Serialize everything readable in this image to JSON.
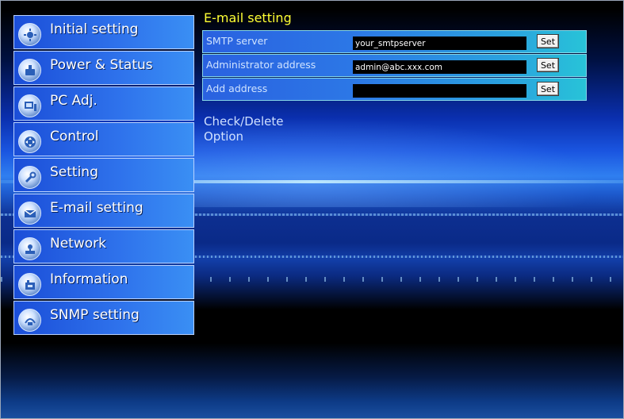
{
  "sidebar": {
    "items": [
      {
        "label": "Initial setting",
        "icon": "initial-setting-icon"
      },
      {
        "label": "Power & Status",
        "icon": "power-status-icon"
      },
      {
        "label": "PC Adj.",
        "icon": "pc-adj-icon"
      },
      {
        "label": "Control",
        "icon": "control-icon"
      },
      {
        "label": "Setting",
        "icon": "setting-icon"
      },
      {
        "label": "E-mail setting",
        "icon": "email-icon"
      },
      {
        "label": "Network",
        "icon": "network-icon"
      },
      {
        "label": "Information",
        "icon": "information-icon"
      },
      {
        "label": "SNMP setting",
        "icon": "snmp-icon"
      }
    ]
  },
  "main": {
    "title": "E-mail setting",
    "rows": [
      {
        "label": "SMTP server",
        "value": "your_smtpserver",
        "button": "Set"
      },
      {
        "label": "Administrator address",
        "value": "admin@abc.xxx.com",
        "button": "Set"
      },
      {
        "label": "Add address",
        "value": "",
        "button": "Set"
      }
    ],
    "links": {
      "check_delete": "Check/Delete",
      "option": "Option"
    }
  },
  "colors": {
    "title": "#ffff33",
    "nav_gradient_start": "#1b4ed8",
    "row_gradient_end": "#28c3d8",
    "input_bg": "#000000"
  }
}
